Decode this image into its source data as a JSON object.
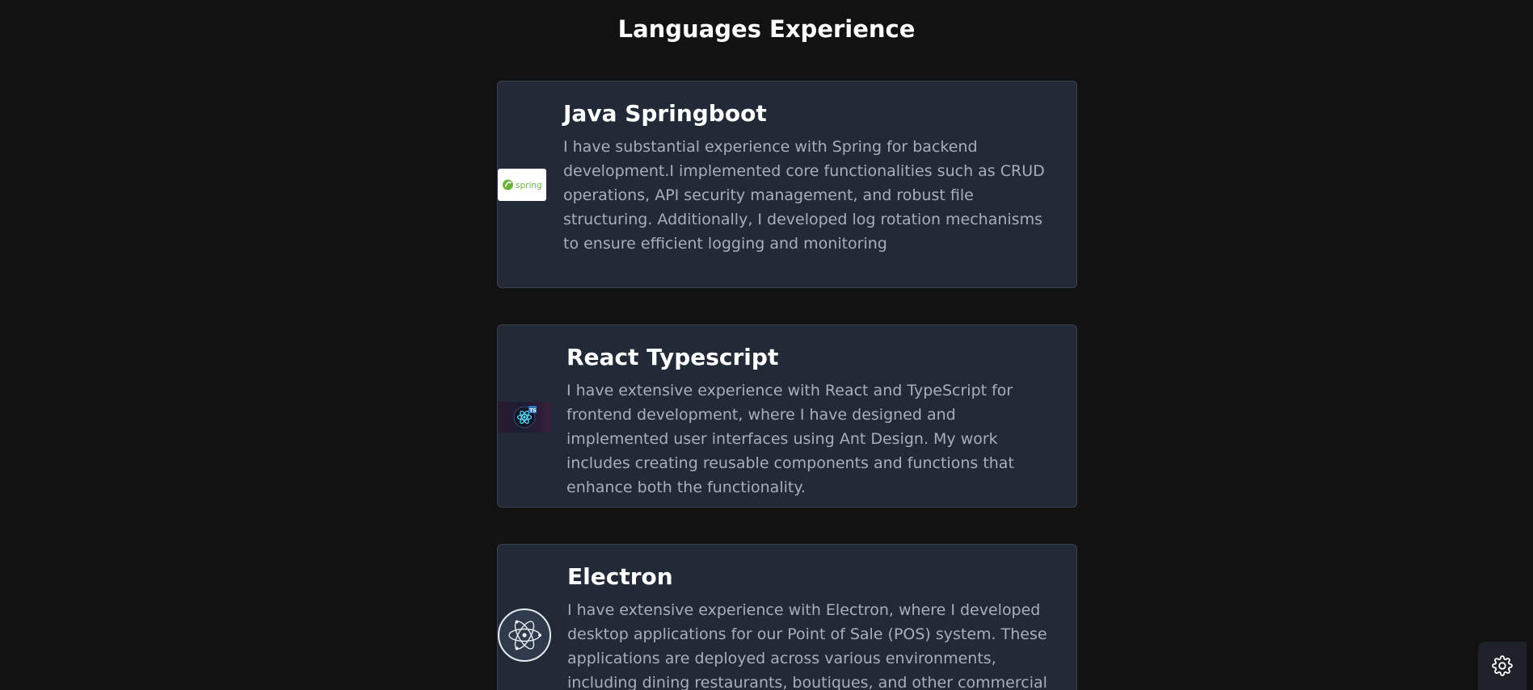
{
  "page": {
    "title": "Languages Experience"
  },
  "cards": [
    {
      "title": "Java Springboot",
      "logo_icon": "spring-logo-icon",
      "logo_text": "spring",
      "description": "I have substantial experience with Spring for backend development.I implemented core functionalities such as CRUD operations, API security management, and robust file structuring. Additionally, I developed log rotation mechanisms to ensure efficient logging and monitoring"
    },
    {
      "title": "React Typescript",
      "logo_icon": "react-typescript-logo-icon",
      "logo_text": "TS",
      "description": "I have extensive experience with React and TypeScript for frontend development, where I have designed and implemented user interfaces using Ant Design. My work includes creating reusable components and functions that enhance both the functionality."
    },
    {
      "title": "Electron",
      "logo_icon": "electron-logo-icon",
      "description": "I have extensive experience with Electron, where I developed desktop applications for our Point of Sale (POS) system. These applications are deployed across various environments, including dining restaurants, boutiques, and other commercial settings."
    }
  ],
  "settings": {
    "icon": "gear-icon"
  },
  "colors": {
    "background": "#121212",
    "card_background": "#222a37",
    "title_text": "#ffffff",
    "body_text": "#a7afbb",
    "spring_green": "#6db33f",
    "react_cyan": "#61dafb",
    "typescript_blue": "#3178c6"
  }
}
